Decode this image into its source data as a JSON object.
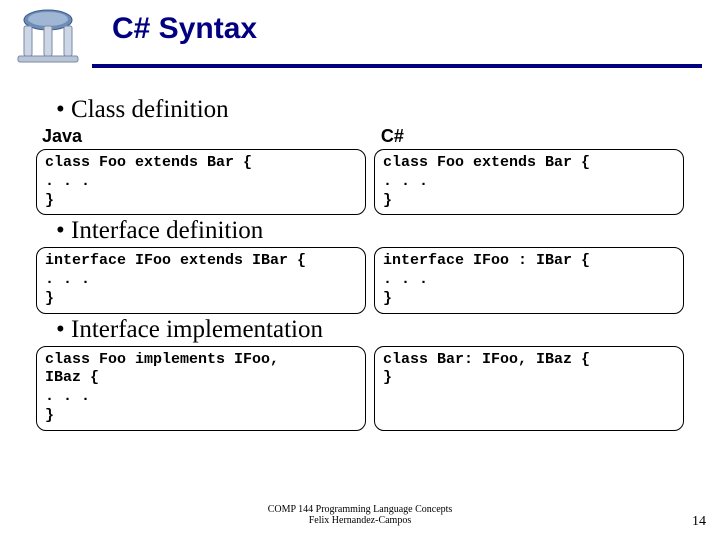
{
  "title": "C# Syntax",
  "headers": {
    "left": "Java",
    "right": "C#"
  },
  "bullets": {
    "b1": "Class definition",
    "b2": "Interface definition",
    "b3": "Interface implementation"
  },
  "code": {
    "classdef": {
      "java": "class Foo extends Bar {\n. . .\n}",
      "cs": "class Foo extends Bar {\n. . .\n}"
    },
    "ifacedef": {
      "java": "interface IFoo extends IBar {\n. . .\n}",
      "cs": "interface IFoo : IBar {\n. . .\n}"
    },
    "ifaceimpl": {
      "java": "class Foo implements IFoo,\nIBaz {\n. . .\n}",
      "cs": "class Bar: IFoo, IBaz {\n}"
    }
  },
  "footer": {
    "line1": "COMP 144 Programming Language Concepts",
    "line2": "Felix Hernandez-Campos"
  },
  "slidenum": "14"
}
